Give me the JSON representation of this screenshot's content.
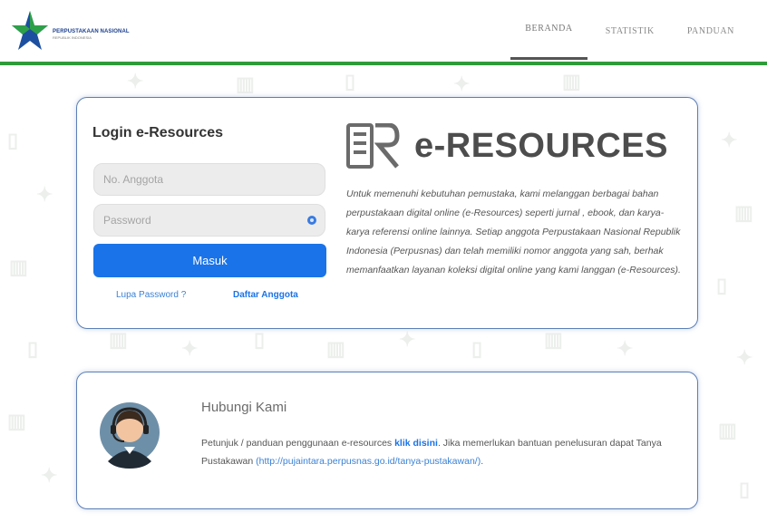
{
  "header": {
    "logo_title": "PERPUSTAKAAN NASIONAL",
    "logo_subtitle": "REPUBLIK INDONESIA",
    "nav": [
      {
        "label": "BERANDA"
      },
      {
        "label": "STATISTIK"
      },
      {
        "label": "PANDUAN"
      }
    ]
  },
  "login": {
    "title": "Login e-Resources",
    "username_placeholder": "No. Anggota",
    "password_placeholder": "Password",
    "submit_label": "Masuk",
    "forgot_label": "Lupa Password ?",
    "register_label": "Daftar Anggota"
  },
  "intro": {
    "title": "e-RESOURCES",
    "description": "Untuk memenuhi kebutuhan pemustaka, kami melanggan berbagai bahan perpustakaan digital online (e-Resources) seperti jurnal , ebook, dan karya-karya referensi online lainnya. Setiap anggota Perpustakaan Nasional Republik Indonesia (Perpusnas) dan telah memiliki nomor anggota yang sah, berhak memanfaatkan layanan koleksi digital online yang kami langgan (e-Resources)."
  },
  "contact": {
    "title": "Hubungi Kami",
    "text_before_link": "Petunjuk / panduan penggunaan e-resources ",
    "link_label": "klik disini",
    "text_after_link": ". Jika memerlukan bantuan penelusuran dapat Tanya Pustakawan ",
    "url_label": "(http://pujaintara.perpusnas.go.id/tanya-pustakawan/)",
    "text_end": "."
  },
  "colors": {
    "accent_green": "#2e9b3a",
    "primary_blue": "#1a73e8",
    "card_border": "#5b7fb6"
  },
  "icons": {
    "logo": "star-logo-icon",
    "password_toggle": "eye-icon",
    "er_logo": "e-resources-logo-icon",
    "agent": "customer-service-agent-icon"
  }
}
